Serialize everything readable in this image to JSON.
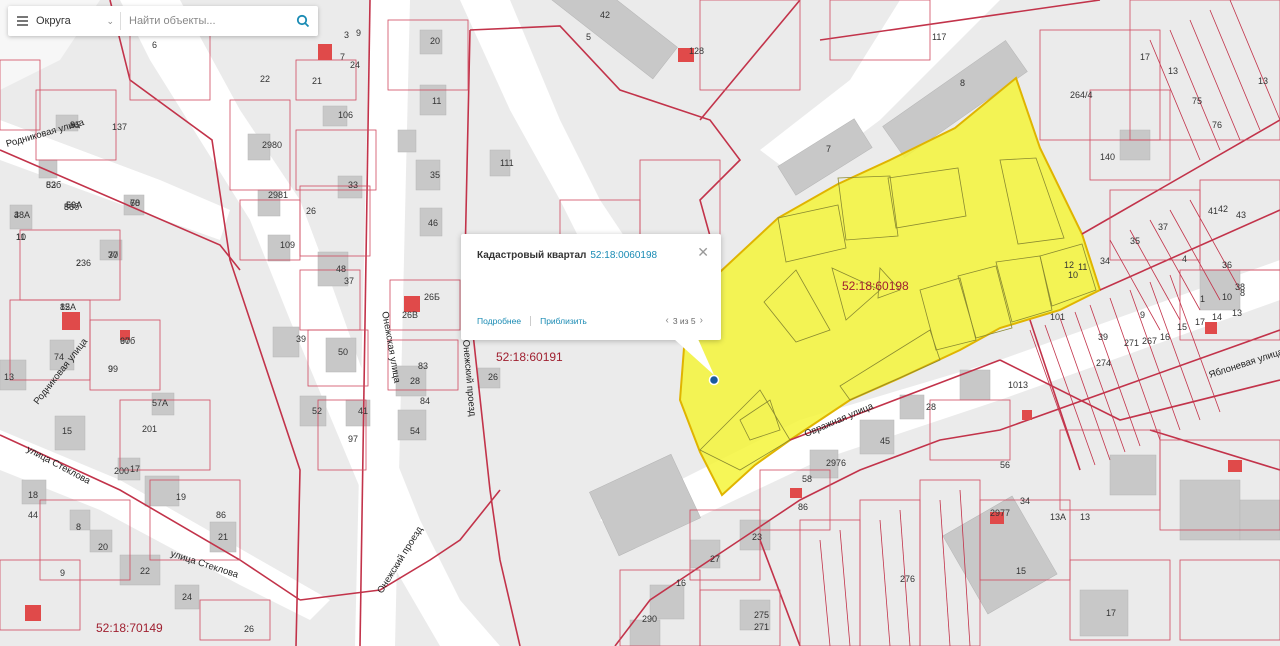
{
  "search": {
    "district_label": "Округа",
    "placeholder": "Найти объекты..."
  },
  "popup": {
    "title": "Кадастровый квартал",
    "number": "52:18:0060198",
    "more_link": "Подробнее",
    "zoom_link": "Приблизить",
    "pager_text": "3 из 5"
  },
  "map": {
    "highlight_color": "#f5f53a",
    "quarter_labels": [
      "52:18:60198",
      "52:18:60191",
      "52:18:70149"
    ],
    "streets": [
      "Родниковая улица",
      "улица Стеклова",
      "Онежская улица",
      "Онежский проезд",
      "Овражная улица",
      "Яблоневая улица"
    ],
    "parcel_labels": [
      "95",
      "83",
      "86",
      "66А",
      "3",
      "68",
      "70",
      "2",
      "10",
      "85",
      "97б",
      "99",
      "74",
      "13",
      "57А",
      "15",
      "201",
      "200",
      "17",
      "18",
      "19",
      "44",
      "8",
      "20",
      "21",
      "22",
      "86",
      "24",
      "26",
      "9",
      "5",
      "42",
      "128",
      "117",
      "8",
      "137",
      "7",
      "140",
      "264/4",
      "17",
      "13",
      "75",
      "76",
      "13",
      "35",
      "37",
      "41",
      "42",
      "43",
      "34",
      "4",
      "36",
      "38",
      "39",
      "274",
      "271",
      "267",
      "16",
      "15",
      "17",
      "14",
      "13",
      "12",
      "11",
      "10",
      "9",
      "1",
      "10",
      "8",
      "6",
      "7",
      "3",
      "9",
      "24",
      "22",
      "21",
      "20",
      "11",
      "106",
      "2980",
      "2981",
      "33",
      "35",
      "26",
      "111",
      "109",
      "46",
      "48",
      "37",
      "26Б",
      "26В",
      "39",
      "50",
      "83",
      "28",
      "26",
      "52",
      "41",
      "84",
      "54",
      "97",
      "112бП",
      "101",
      "1013",
      "2977",
      "56",
      "34",
      "28",
      "45",
      "2976",
      "58",
      "86",
      "23",
      "27",
      "16",
      "290",
      "275",
      "271",
      "276",
      "17",
      "15",
      "13",
      "13А",
      "8",
      "52б",
      "50б",
      "50А",
      "48А",
      "70",
      "37",
      "236",
      "11",
      "12А",
      "60",
      "9"
    ]
  }
}
